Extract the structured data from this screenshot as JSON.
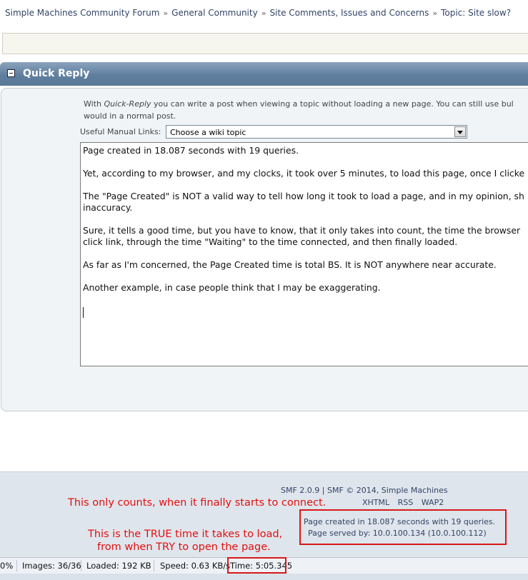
{
  "breadcrumb": {
    "items": [
      "Simple Machines Community Forum",
      "General Community",
      "Site Comments, Issues and Concerns",
      "Topic: Site slow?"
    ],
    "separator": "»"
  },
  "quick_reply": {
    "title": "Quick Reply",
    "intro_prefix": "With ",
    "intro_em": "Quick-Reply",
    "intro_rest": " you can write a post when viewing a topic without loading a new page. You can still use bul",
    "intro_line2": "would in a normal post.",
    "manual_label": "Useful Manual Links:",
    "manual_select_value": "Choose a wiki topic",
    "message_lines": [
      "Page created in 18.087 seconds with 19 queries.",
      "Yet, according to my browser, and my clocks, it took over 5 minutes, to load this page, once I clicke",
      "The \"Page Created\" is NOT a valid way to tell how long it took to load a page, and in my opinion, sh",
      "inaccuracy.",
      "Sure, it tells a good time, but you have to know, that it only takes into count, the time the browser",
      "click link, through the time \"Waiting\" to the time connected, and then finally loaded.",
      "As far as I'm concerned, the Page Created time is total BS. It is NOT anywhere near accurate.",
      "Another example, in case people think that I may be exaggerating."
    ]
  },
  "footer": {
    "copyright": "SMF 2.0.9 | SMF © 2014, Simple Machines",
    "links": [
      "XHTML",
      "RSS",
      "WAP2"
    ],
    "page_created": "Page created in 18.087 seconds with 19 queries.",
    "page_served": "Page served by: 10.0.100.134 (10.0.100.112)"
  },
  "annotations": {
    "connect_note": "This only counts, when it finally starts to connect.",
    "true_time_line1": "This is the TRUE time it takes to load,",
    "true_time_line2": "from when TRY to open the page.",
    "color": "#e01010"
  },
  "status_bar": {
    "percent": "0%",
    "images": "Images: 36/36",
    "loaded": "Loaded: 192 KB",
    "speed": "Speed: 0.63 KB/s",
    "time": "Time: 5:05.345"
  },
  "colors": {
    "header_blue": "#5f7f9f",
    "link": "#334466",
    "panel_bg": "#f0f4f7",
    "footer_bg": "#dfe5ec"
  }
}
